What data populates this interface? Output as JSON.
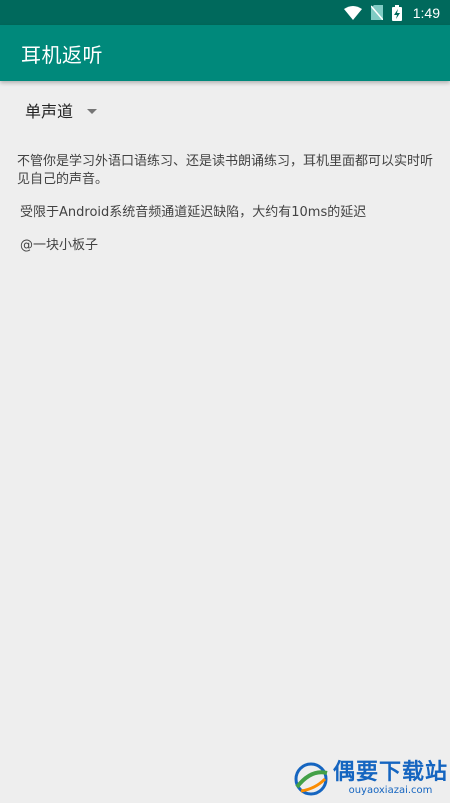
{
  "status_bar": {
    "time": "1:49",
    "icons": [
      "wifi-icon",
      "no-sim-icon",
      "battery-charging-icon"
    ],
    "background": "#00695c"
  },
  "app_bar": {
    "title": "耳机返听",
    "background": "#00897b"
  },
  "channel_spinner": {
    "selected": "单声道"
  },
  "content": {
    "description": "不管你是学习外语口语练习、还是读书朗诵练习，耳机里面都可以实时听见自己的声音。",
    "latency_note": "受限于Android系统音频通道延迟缺陷，大约有10ms的延迟",
    "author": "@一块小板子"
  },
  "watermark": {
    "main": "偶要下载站",
    "sub": "ouyaoxiazai.com",
    "color": "#1565c0"
  }
}
